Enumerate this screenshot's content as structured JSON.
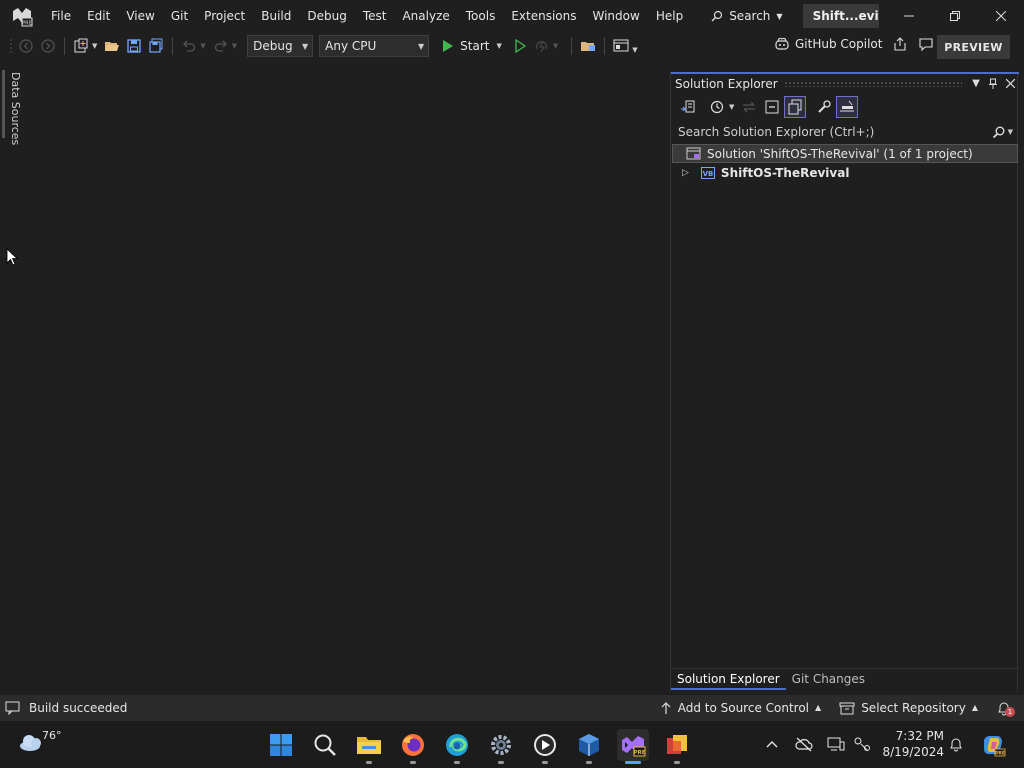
{
  "menu": {
    "items": [
      "File",
      "Edit",
      "View",
      "Git",
      "Project",
      "Build",
      "Debug",
      "Test",
      "Analyze",
      "Tools",
      "Extensions",
      "Window",
      "Help"
    ],
    "search_label": "Search",
    "solution_chip": "Shift...evival"
  },
  "toolbar": {
    "config": "Debug",
    "platform": "Any CPU",
    "start_label": "Start",
    "copilot_label": "GitHub Copilot",
    "preview_label": "PREVIEW"
  },
  "left_rail": {
    "label": "Data Sources"
  },
  "solution_explorer": {
    "title": "Solution Explorer",
    "search_placeholder": "Search Solution Explorer (Ctrl+;)",
    "solution_row": "Solution 'ShiftOS-TheRevival' (1 of 1 project)",
    "project_row": "ShiftOS-TheRevival",
    "tabs": [
      "Solution Explorer",
      "Git Changes"
    ]
  },
  "statusbar": {
    "message": "Build succeeded",
    "source_control": "Add to Source Control",
    "repository": "Select Repository",
    "notification_count": "1"
  },
  "taskbar": {
    "weather_temp": "76°",
    "time": "7:32 PM",
    "date": "8/19/2024"
  },
  "colors": {
    "background": "#1f1f1f",
    "accent": "#4a6ec9",
    "vs_purple": "#a370f7",
    "play_green": "#3fb950"
  }
}
